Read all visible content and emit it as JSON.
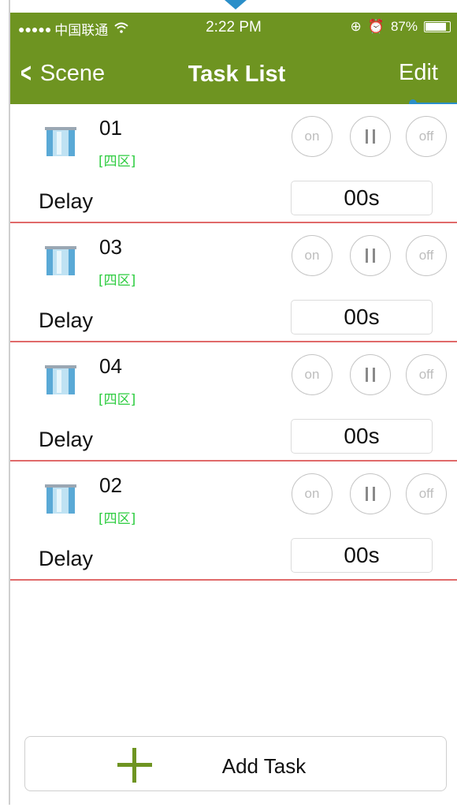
{
  "status_bar": {
    "signal_dots": "●●●●●",
    "carrier": "中国联通",
    "wifi_icon": "wifi-icon",
    "time": "2:22 PM",
    "lock_glyph": "⊕",
    "alarm_glyph": "⏰",
    "battery": "87%",
    "battery_level": 0.87
  },
  "nav": {
    "back_label": "Scene",
    "back_glyph": "<",
    "title": "Task List",
    "edit_label": "Edit"
  },
  "controls": {
    "on_label": "on",
    "off_label": "off"
  },
  "tasks": [
    {
      "name": "01",
      "zone": "[四区]",
      "delay_label": "Delay",
      "delay_value": "00s"
    },
    {
      "name": "03",
      "zone": "[四区]",
      "delay_label": "Delay",
      "delay_value": "00s"
    },
    {
      "name": "04",
      "zone": "[四区]",
      "delay_label": "Delay",
      "delay_value": "00s"
    },
    {
      "name": "02",
      "zone": "[四区]",
      "delay_label": "Delay",
      "delay_value": "00s"
    }
  ],
  "add_task": {
    "label": "Add Task"
  },
  "colors": {
    "header_green": "#6e9421",
    "separator_red": "#e06a6a",
    "zone_green": "#2ecc40",
    "accent_blue": "#2b8fc9"
  }
}
